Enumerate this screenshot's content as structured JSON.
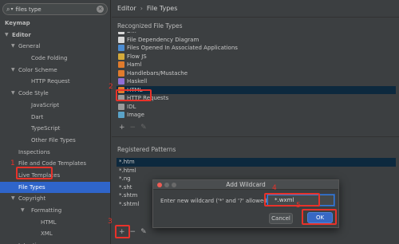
{
  "search": {
    "value": "files type"
  },
  "tree": [
    {
      "label": "Keymap",
      "level": 0,
      "bold": true,
      "arrow": ""
    },
    {
      "label": "Editor",
      "level": 0,
      "bold": true,
      "arrow": "▼"
    },
    {
      "label": "General",
      "level": 1,
      "arrow": "▼"
    },
    {
      "label": "Code Folding",
      "level": 2,
      "arrow": ""
    },
    {
      "label": "Color Scheme",
      "level": 1,
      "arrow": "▼"
    },
    {
      "label": "HTTP Request",
      "level": 2,
      "arrow": ""
    },
    {
      "label": "Code Style",
      "level": 1,
      "arrow": "▼"
    },
    {
      "label": "JavaScript",
      "level": 2,
      "arrow": ""
    },
    {
      "label": "Dart",
      "level": 2,
      "arrow": ""
    },
    {
      "label": "TypeScript",
      "level": 2,
      "arrow": ""
    },
    {
      "label": "Other File Types",
      "level": 2,
      "arrow": ""
    },
    {
      "label": "Inspections",
      "level": 1,
      "arrow": ""
    },
    {
      "label": "File and Code Templates",
      "level": 1,
      "arrow": ""
    },
    {
      "label": "Live Templates",
      "level": 1,
      "arrow": ""
    },
    {
      "label": "File Types",
      "level": 1,
      "arrow": "",
      "selected": true
    },
    {
      "label": "Copyright",
      "level": 1,
      "arrow": "▼"
    },
    {
      "label": "Formatting",
      "level": 2,
      "arrow": "▼"
    },
    {
      "label": "HTML",
      "level": 3,
      "arrow": ""
    },
    {
      "label": "XML",
      "level": 3,
      "arrow": ""
    },
    {
      "label": "Intentions",
      "level": 1,
      "arrow": ""
    }
  ],
  "breadcrumb": {
    "parent": "Editor",
    "separator": "›",
    "current": "File Types"
  },
  "recognized": {
    "title": "Recognized File Types",
    "items": [
      {
        "label": "Diff",
        "icon": "file"
      },
      {
        "label": "File Dependency Diagram",
        "icon": "file"
      },
      {
        "label": "Files Opened In Associated Applications",
        "icon": "blue"
      },
      {
        "label": "Flow JS",
        "icon": "yellow"
      },
      {
        "label": "Haml",
        "icon": "orange"
      },
      {
        "label": "Handlebars/Mustache",
        "icon": "orange"
      },
      {
        "label": "Haskell",
        "icon": "purple"
      },
      {
        "label": "HTML",
        "icon": "orange",
        "selected": true
      },
      {
        "label": "HTTP Requests",
        "icon": "gray"
      },
      {
        "label": "IDL",
        "icon": "gray"
      },
      {
        "label": "Image",
        "icon": "img"
      }
    ]
  },
  "patterns": {
    "title": "Registered Patterns",
    "items": [
      "*.htm",
      "*.html",
      "*.ng",
      "*.sht",
      "*.shtm",
      "*.shtml"
    ]
  },
  "toolbar": {
    "add": "+",
    "remove": "−",
    "edit": "✎"
  },
  "dialog": {
    "title": "Add Wildcard",
    "label": "Enter new wildcard ('*' and '?' allowed):",
    "value": "*.wxml",
    "cancel": "Cancel",
    "ok": "OK"
  },
  "annotations": [
    "1",
    "2",
    "3",
    "4",
    "5"
  ],
  "colors": {
    "annotation": "#e8322a",
    "selection": "#2f65ca",
    "ok": "#3768c4"
  }
}
